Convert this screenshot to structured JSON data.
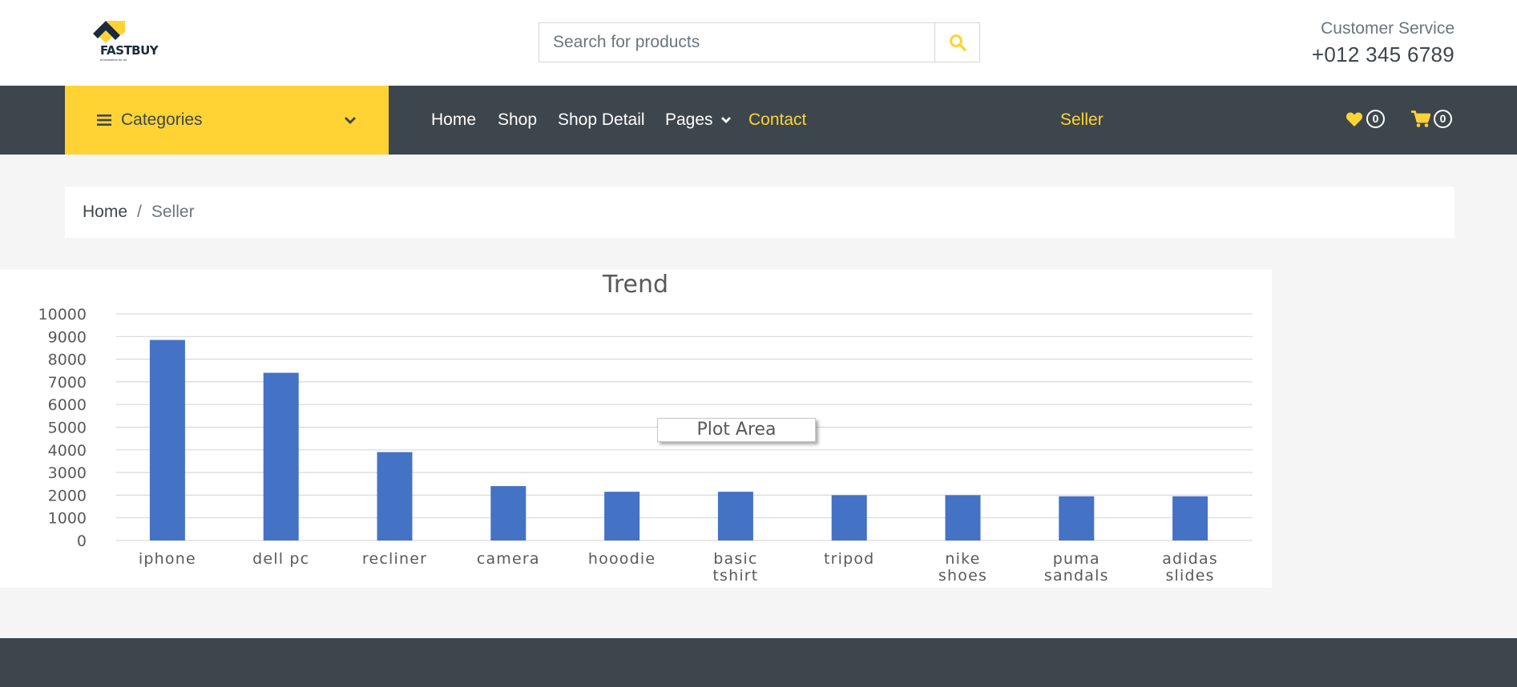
{
  "header": {
    "logo_text": "FASTBUY",
    "logo_tagline": "eCommerce for all",
    "search_placeholder": "Search for products",
    "customer_service_label": "Customer Service",
    "customer_service_phone": "+012 345 6789"
  },
  "nav": {
    "categories_label": "Categories",
    "links": [
      {
        "label": "Home"
      },
      {
        "label": "Shop"
      },
      {
        "label": "Shop Detail"
      },
      {
        "label": "Pages"
      },
      {
        "label": "Contact"
      },
      {
        "label": "Seller"
      }
    ],
    "wishlist_count": "0",
    "cart_count": "0"
  },
  "breadcrumb": {
    "home": "Home",
    "separator": "/",
    "current": "Seller"
  },
  "colors": {
    "accent": "#ffd333",
    "dark": "#3d464d",
    "bar": "#4472c4"
  },
  "tooltip": "Plot Area",
  "chart_data": {
    "type": "bar",
    "title": "Trend",
    "categories": [
      [
        "iphone"
      ],
      [
        "dell pc"
      ],
      [
        "recliner"
      ],
      [
        "camera"
      ],
      [
        "hooodie"
      ],
      [
        "basic",
        "tshirt"
      ],
      [
        "tripod"
      ],
      [
        "nike",
        "shoes"
      ],
      [
        "puma",
        "sandals"
      ],
      [
        "adidas",
        "slides"
      ]
    ],
    "values": [
      8850,
      7400,
      3900,
      2400,
      2150,
      2150,
      2000,
      2000,
      1950,
      1950
    ],
    "ylim": [
      0,
      10000
    ],
    "yticks": [
      0,
      1000,
      2000,
      3000,
      4000,
      5000,
      6000,
      7000,
      8000,
      9000,
      10000
    ],
    "grid": true
  }
}
